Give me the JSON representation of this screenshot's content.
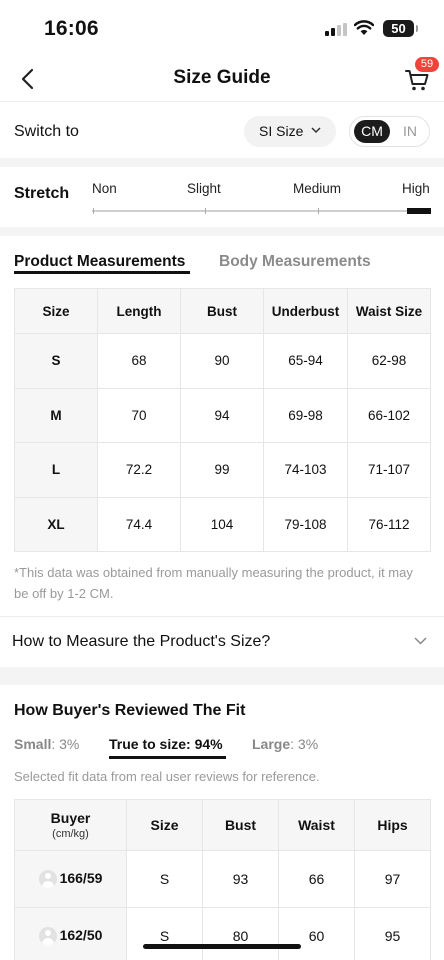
{
  "status_bar": {
    "time": "16:06",
    "battery": "50"
  },
  "header": {
    "title": "Size Guide",
    "cart_count": "59"
  },
  "switch": {
    "label": "Switch to",
    "size_system": "SI Size",
    "unit_cm": "CM",
    "unit_in": "IN",
    "selected_unit": "CM"
  },
  "stretch": {
    "label": "Stretch",
    "options": [
      "Non",
      "Slight",
      "Medium",
      "High"
    ],
    "selected": "High"
  },
  "tabs": {
    "product": "Product Measurements",
    "body": "Body Measurements",
    "active": "Product Measurements"
  },
  "measurements": {
    "headers": [
      "Size",
      "Length",
      "Bust",
      "Underbust",
      "Waist Size"
    ],
    "rows": [
      [
        "S",
        "68",
        "90",
        "65-94",
        "62-98"
      ],
      [
        "M",
        "70",
        "94",
        "69-98",
        "66-102"
      ],
      [
        "L",
        "72.2",
        "99",
        "74-103",
        "71-107"
      ],
      [
        "XL",
        "74.4",
        "104",
        "79-108",
        "76-112"
      ]
    ]
  },
  "note": "*This data was obtained from manually measuring the product, it may be off by 1-2 CM.",
  "how_to_measure": "How to Measure the Product's Size?",
  "buyer_fit": {
    "title": "How Buyer's Reviewed The Fit",
    "small_label": "Small",
    "small_value": ": 3%",
    "true_label": "True to size: 94%",
    "large_label": "Large",
    "large_value": ": 3%",
    "note": "Selected fit data from real user reviews for reference.",
    "headers": [
      "Buyer",
      "Size",
      "Bust",
      "Waist",
      "Hips"
    ],
    "buyer_sub": "(cm/kg)",
    "rows": [
      [
        "166/59",
        "S",
        "93",
        "66",
        "97"
      ],
      [
        "162/50",
        "S",
        "80",
        "60",
        "95"
      ]
    ]
  }
}
